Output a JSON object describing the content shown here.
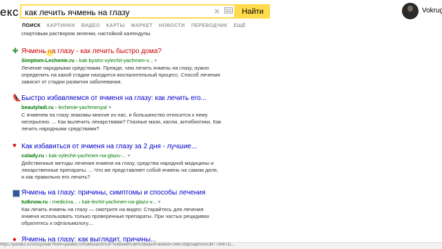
{
  "header": {
    "logo": "екс",
    "search_value": "как лечить ячмень на глазу",
    "search_button": "Найти",
    "username": "VokrugO"
  },
  "tabs": [
    "ПОИСК",
    "КАРТИНКИ",
    "ВИДЕО",
    "КАРТЫ",
    "МАРКЕТ",
    "НОВОСТИ",
    "ПЕРЕВОДЧИК",
    "ЕЩЁ"
  ],
  "top_snippet": "спиртовым раствором зеленки, настойкой календулы.",
  "results": [
    {
      "title": "Ячмень на глазу - как лечить быстро дома?",
      "domain": "Simptom-Lechenie.ru",
      "path": "› kak-bystro-vylechit-yachmen-v...",
      "snippet": "Лечение народными средствами. Прежде, чем лечить ячмень на глазу, нужно определить на какой стадии находится воспалительный процесс. Способ лечения зависит от стадии развития заболевания."
    },
    {
      "title": "Быстро избавляемся от ячменя на глазу: как лечить его...",
      "domain": "beautyladi.ru",
      "path": "› lechenie-yachmenya/",
      "snippet": "С ячменем на глазу знакомы многие из нас, и большинство относится к нему несерьезно. ... Как вылечить лекарствами? Глазные мази, капли, антибиотики. Как лечить народными средствами?"
    },
    {
      "title": "Как избавиться от ячменя на глазу за 2 дня - лучшие...",
      "domain": "colady.ru",
      "path": "› kak-vylechit-yachmen-na-glazu-...",
      "snippet": "Действенные методы лечения ячменя на глазу, средства народной медицины и лекарственные препараты. ... Что же представляет собой ячмень на самом деле, и как правильно его лечить?"
    },
    {
      "title": "Ячмень на глазу: причины, симптомы и способы лечения",
      "domain": "tutknow.ru",
      "path": "› medicina... › kak-lechit-yachmen-na-glazu-v...",
      "snippet": "Как лечить ячмень на глазу — смотрите на видео: Старайтесь для лечения ячменя использовать только проверенные препараты. При частых рецидивах обратитесь к офтальмологу...."
    },
    {
      "title": "Ячмень на глазу: как выглядит, причины...",
      "domain": "",
      "path": "",
      "snippet": ""
    }
  ],
  "status_text": "https://yandex.ru/clck/jsredir?from=yandex.ru%3Bsearch%2F%3Bweb%3B%3B&text=&etext=1460.RbpSapmnmUMT7nh8TIC..."
}
